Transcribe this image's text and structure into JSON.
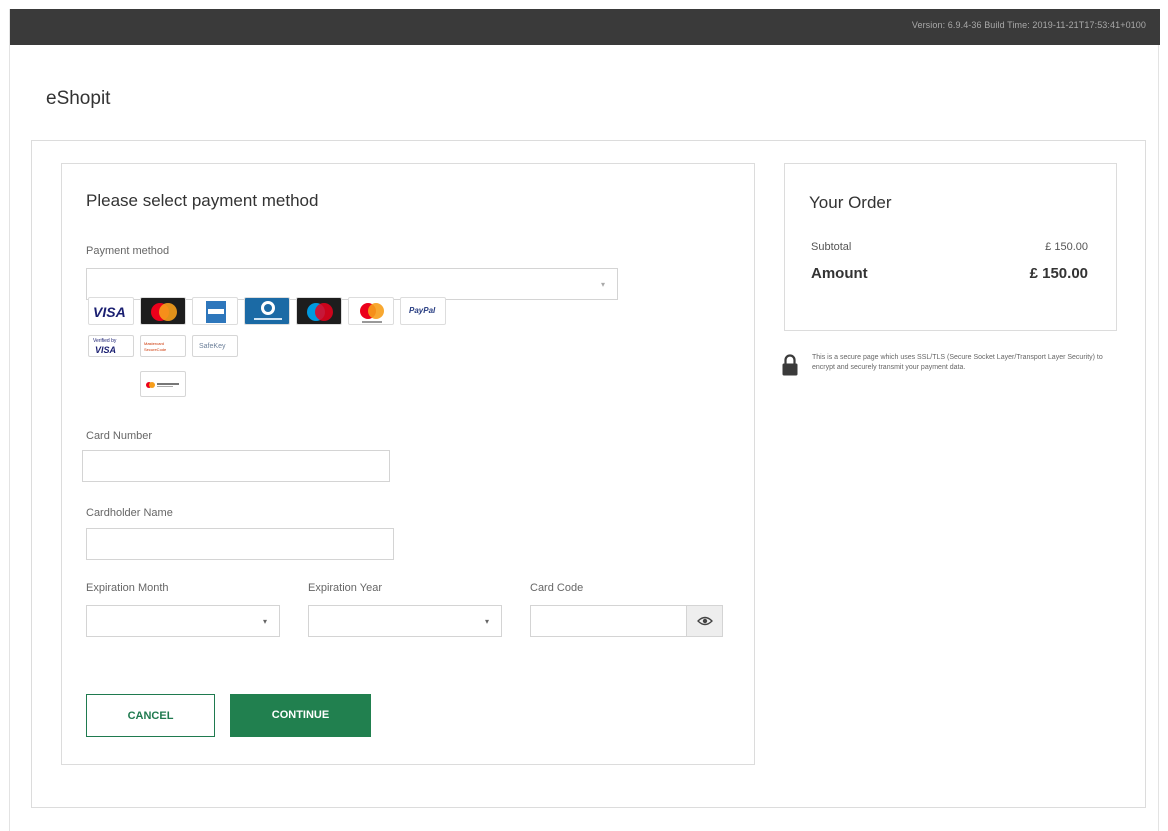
{
  "topbar": {
    "version": "Version: 6.9.4-36 Build Time: 2019-11-21T17:53:41+0100"
  },
  "brand": {
    "name": "eShopit"
  },
  "payment": {
    "title": "Please select payment method",
    "method_label": "Payment method",
    "method_value": "",
    "cards": {
      "visa": "VISA",
      "paypal": "PayPal",
      "verified_visa_top": "Verified by",
      "verified_visa_bottom": "VISA",
      "mastercard_securecode": "Mastercard SecureCode",
      "safekey": "SafeKey"
    },
    "card_number_label": "Card Number",
    "card_number_value": "",
    "cardholder_label": "Cardholder Name",
    "cardholder_value": "",
    "exp_month_label": "Expiration Month",
    "exp_year_label": "Expiration Year",
    "card_code_label": "Card Code",
    "cancel_label": "CANCEL",
    "continue_label": "CONTINUE"
  },
  "order": {
    "title": "Your Order",
    "subtotal_label": "Subtotal",
    "subtotal_value": "£ 150.00",
    "amount_label": "Amount",
    "amount_value": "£ 150.00"
  },
  "secure_note": "This is a secure page which uses SSL/TLS (Secure Socket Layer/Transport Layer Security) to encrypt and securely transmit your payment data.",
  "colors": {
    "topbar": "#3a3a3a",
    "primary_green": "#21804f",
    "border": "#dcdcdc"
  },
  "icons": {
    "dropdown": "chevron-down-icon",
    "eye": "eye-icon",
    "lock": "lock-icon"
  }
}
